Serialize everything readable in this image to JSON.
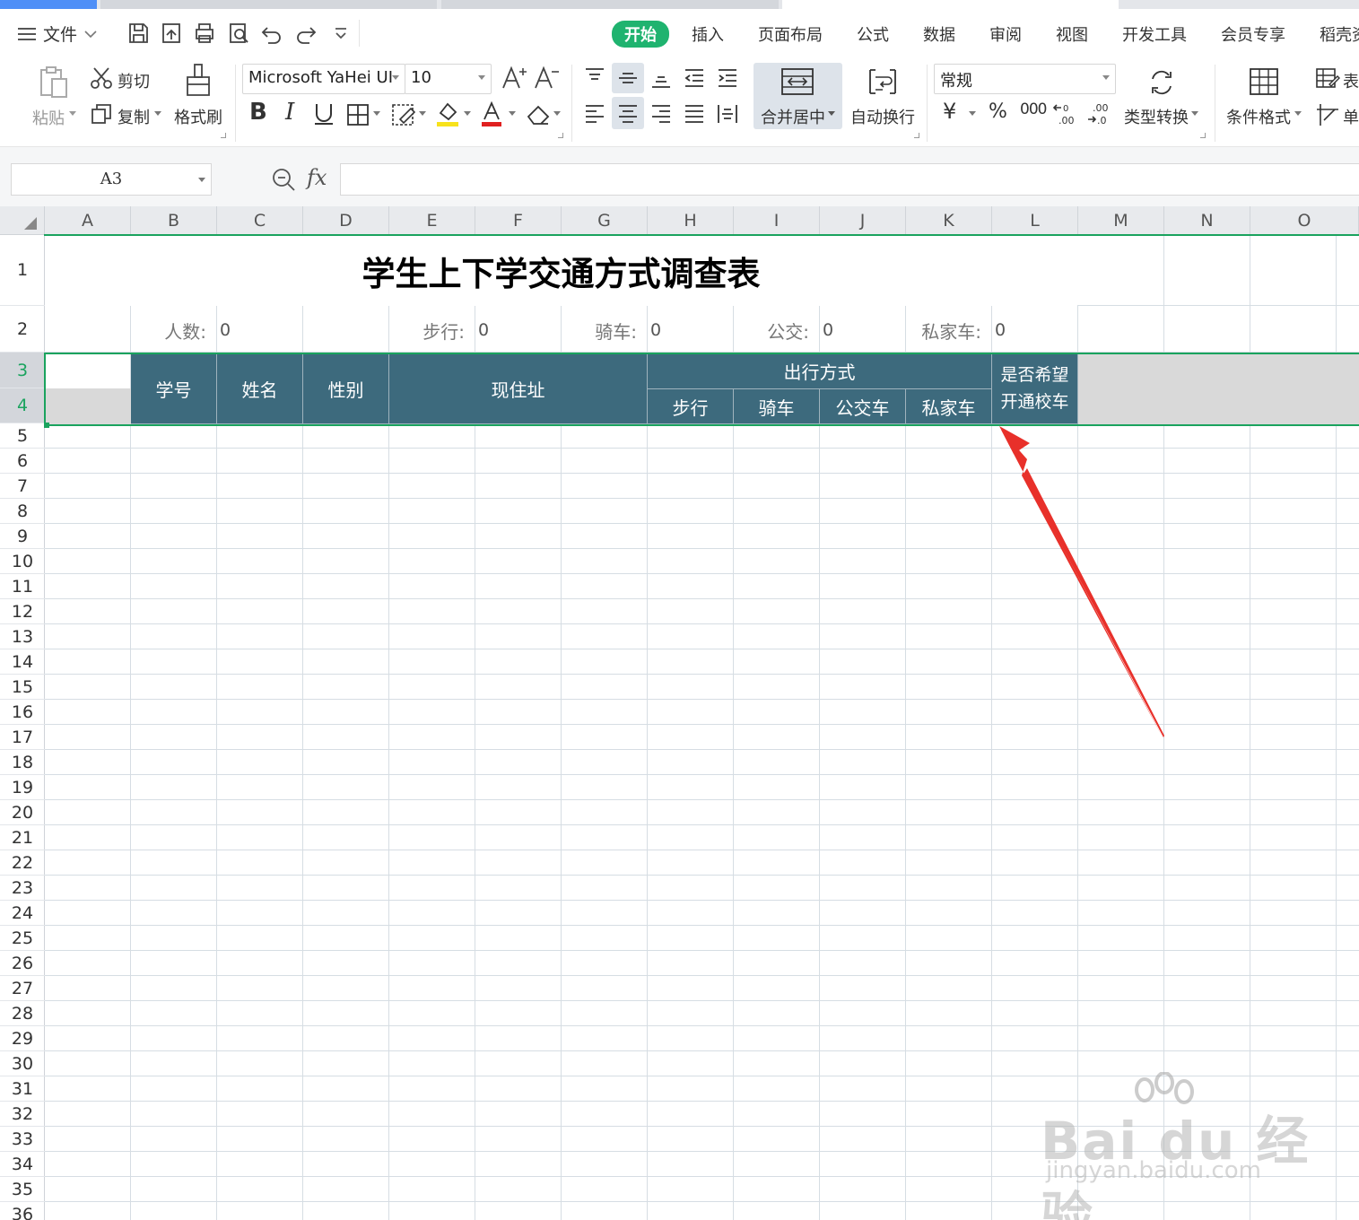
{
  "menu": {
    "file_label": "文件",
    "tabs": [
      "开始",
      "插入",
      "页面布局",
      "公式",
      "数据",
      "审阅",
      "视图",
      "开发工具",
      "会员专享",
      "稻壳资"
    ],
    "active_tab": "开始"
  },
  "ribbon": {
    "paste": "粘贴",
    "cut": "剪切",
    "copy": "复制",
    "format_painter": "格式刷",
    "font_name": "Microsoft YaHei UI",
    "font_size": "10",
    "merge_center": "合并居中",
    "wrap_text": "自动换行",
    "number_format": "常规",
    "type_convert": "类型转换",
    "conditional_format": "条件格式",
    "table_style": "表",
    "cell": "单"
  },
  "formula_bar": {
    "cell_ref": "A3",
    "fx": "fx",
    "content": ""
  },
  "columns": [
    "A",
    "B",
    "C",
    "D",
    "E",
    "F",
    "G",
    "H",
    "I",
    "J",
    "K",
    "L",
    "M",
    "N",
    "O"
  ],
  "rows": [
    "1",
    "2",
    "3",
    "4",
    "5",
    "6",
    "7",
    "8",
    "9",
    "10",
    "11",
    "12",
    "13",
    "14",
    "15",
    "16",
    "17",
    "18",
    "19",
    "20",
    "21",
    "22",
    "23",
    "24",
    "25",
    "26",
    "27",
    "28",
    "29",
    "30",
    "31",
    "32",
    "33",
    "34",
    "35",
    "36"
  ],
  "sheet": {
    "title": "学生上下学交通方式调查表",
    "stats": [
      {
        "label": "人数:",
        "value": "0"
      },
      {
        "label": "步行:",
        "value": "0"
      },
      {
        "label": "骑车:",
        "value": "0"
      },
      {
        "label": "公交:",
        "value": "0"
      },
      {
        "label": "私家车:",
        "value": "0"
      }
    ],
    "headers": {
      "student_id": "学号",
      "name": "姓名",
      "gender": "性别",
      "address": "现住址",
      "travel_mode": "出行方式",
      "walk": "步行",
      "bike": "骑车",
      "bus": "公交车",
      "car": "私家车",
      "school_bus_line1": "是否希望",
      "school_bus_line2": "开通校车"
    }
  },
  "watermark": {
    "logo": "Bai du 经验",
    "url": "jingyan.baidu.com"
  },
  "colors": {
    "accent": "#1fb36f",
    "header_fill": "#3d6a7d",
    "arrow": "#e8302a"
  }
}
